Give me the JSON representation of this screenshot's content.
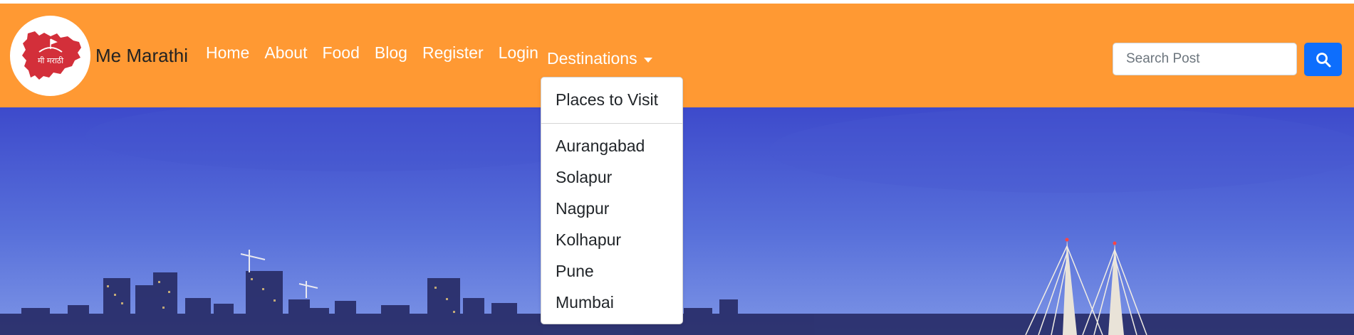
{
  "brand": {
    "name": "Me Marathi",
    "logo_text": "मी मराठी"
  },
  "nav": {
    "links": [
      "Home",
      "About",
      "Food",
      "Blog",
      "Register",
      "Login"
    ],
    "dropdown_label": "Destinations"
  },
  "dropdown": {
    "header_item": "Places to Visit",
    "items": [
      "Aurangabad",
      "Solapur",
      "Nagpur",
      "Kolhapur",
      "Pune",
      "Mumbai"
    ]
  },
  "search": {
    "placeholder": "Search Post",
    "value": "",
    "button_icon": "search-icon"
  },
  "colors": {
    "navbar": "#ff9933",
    "search_button": "#0d6efd",
    "logo_map": "#d32f3a"
  },
  "hero": {
    "image": "city-skyline-and-sea-link-bridge-at-dusk"
  }
}
